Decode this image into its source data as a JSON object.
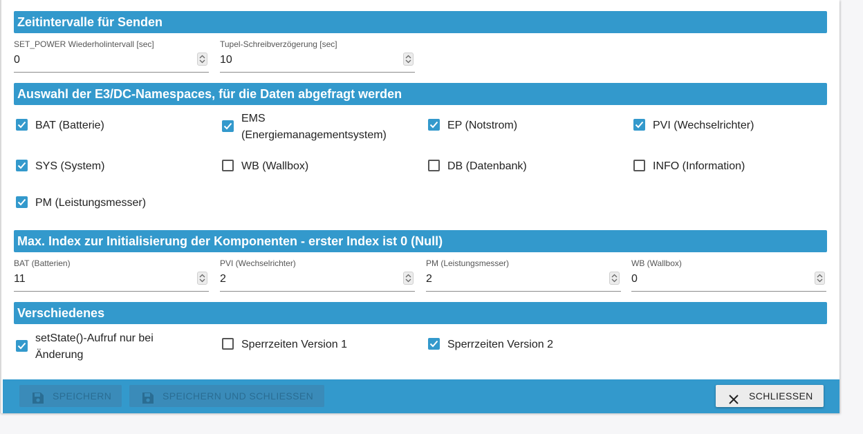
{
  "sections": {
    "intervals": {
      "title": "Zeitintervalle für Senden",
      "fields": [
        {
          "label": "SET_POWER Wiederholintervall [sec]",
          "value": "0"
        },
        {
          "label": "Tupel-Schreibverzögerung [sec]",
          "value": "10"
        }
      ]
    },
    "namespaces": {
      "title": "Auswahl der E3/DC-Namespaces, für die Daten abgefragt werden",
      "items": [
        {
          "label": "BAT (Batterie)",
          "checked": true
        },
        {
          "label": "EMS (Energiemanagementsystem)",
          "checked": true,
          "line1": "EMS",
          "line2": "(Energiemanagementsystem)"
        },
        {
          "label": "EP (Notstrom)",
          "checked": true
        },
        {
          "label": "PVI (Wechselrichter)",
          "checked": true
        },
        {
          "label": "SYS (System)",
          "checked": true
        },
        {
          "label": "WB (Wallbox)",
          "checked": false
        },
        {
          "label": "DB (Datenbank)",
          "checked": false
        },
        {
          "label": "INFO (Information)",
          "checked": false
        },
        {
          "label": "PM (Leistungsmesser)",
          "checked": true
        }
      ]
    },
    "max_index": {
      "title": "Max. Index zur Initialisierung der Komponenten - erster Index ist 0 (Null)",
      "fields": [
        {
          "label": "BAT (Batterien)",
          "value": "11"
        },
        {
          "label": "PVI (Wechselrichter)",
          "value": "2"
        },
        {
          "label": "PM (Leistungsmesser)",
          "value": "2"
        },
        {
          "label": "WB (Wallbox)",
          "value": "0"
        }
      ]
    },
    "misc": {
      "title": "Verschiedenes",
      "items": [
        {
          "label": "setState()-Aufruf nur bei Änderung",
          "checked": true,
          "line1": "setState()-Aufruf nur bei",
          "line2": "Änderung"
        },
        {
          "label": "Sperrzeiten Version 1",
          "checked": false
        },
        {
          "label": "Sperrzeiten Version 2",
          "checked": true
        }
      ]
    }
  },
  "footer": {
    "save_label": "SPEICHERN",
    "save_close_label": "SPEICHERN UND SCHLIESSEN",
    "close_label": "SCHLIESSEN"
  },
  "colors": {
    "accent": "#3399cc",
    "disabled_button": "#3a8bb9",
    "close_button": "#ececec"
  },
  "icons": {
    "save": "floppy-disk-icon",
    "close": "close-x-icon",
    "check": "checkmark-icon",
    "spinner": "up-down-spinner-icon"
  }
}
